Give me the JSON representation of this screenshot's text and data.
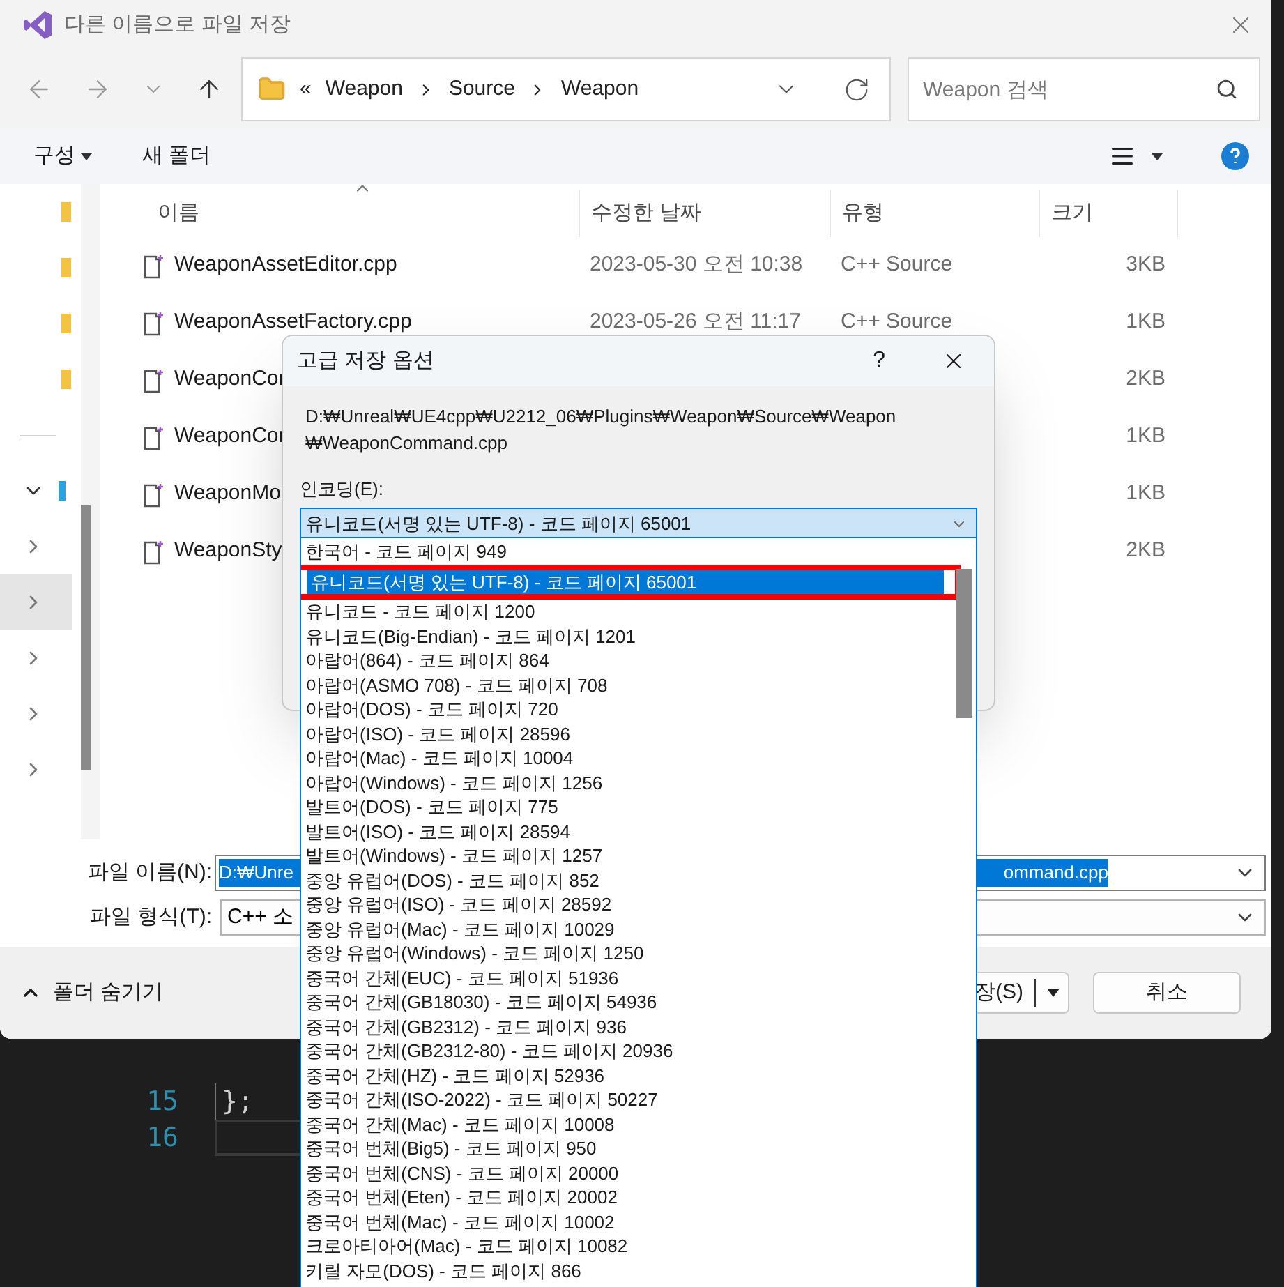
{
  "window": {
    "title": "다른 이름으로 파일 저장"
  },
  "address_bar": {
    "overflow": "«",
    "path": [
      "Weapon",
      "Source",
      "Weapon"
    ]
  },
  "search": {
    "placeholder": "Weapon 검색"
  },
  "toolbar": {
    "organize": "구성",
    "new_folder": "새 폴더"
  },
  "nav_pane": {
    "items": [
      {
        "kind": "folder"
      },
      {
        "kind": "folder"
      },
      {
        "kind": "folder"
      },
      {
        "kind": "folder"
      },
      {
        "kind": "divider"
      },
      {
        "kind": "node",
        "expanded": true,
        "selected": false
      },
      {
        "kind": "node",
        "expanded": false,
        "selected": false
      },
      {
        "kind": "node",
        "expanded": false,
        "selected": true
      },
      {
        "kind": "node",
        "expanded": false,
        "selected": false
      },
      {
        "kind": "node",
        "expanded": false,
        "selected": false
      },
      {
        "kind": "node",
        "expanded": false,
        "selected": false
      }
    ]
  },
  "columns": [
    "이름",
    "수정한 날짜",
    "유형",
    "크기"
  ],
  "files": [
    {
      "name": "WeaponAssetEditor.cpp",
      "modified": "2023-05-30 오전 10:38",
      "type": "C++ Source",
      "size": "3KB"
    },
    {
      "name": "WeaponAssetFactory.cpp",
      "modified": "2023-05-26 오전 11:17",
      "type": "C++ Source",
      "size": "1KB"
    },
    {
      "name": "WeaponCor",
      "size": "2KB"
    },
    {
      "name": "WeaponCor",
      "size": "1KB"
    },
    {
      "name": "WeaponMo",
      "size": "1KB"
    },
    {
      "name": "WeaponSty",
      "size": "2KB"
    }
  ],
  "file_name": {
    "label": "파일 이름(N):",
    "value_start": "D:₩Unre",
    "value_end": "ommand.cpp"
  },
  "file_type": {
    "label": "파일 형식(T):",
    "value": "C++ 소"
  },
  "hide_folders": "폴더 숨기기",
  "save_button": "장(S)",
  "cancel_button": "취소",
  "advanced_dialog": {
    "title": "고급 저장 옵션",
    "help": "?",
    "path_lines": [
      "D:₩Unreal₩UE4cpp₩U2212_06₩Plugins₩Weapon₩Source₩Weapon",
      "₩WeaponCommand.cpp"
    ],
    "encoding_label": "인코딩(E):",
    "encoding_value": "유니코드(서명 있는 UTF-8) - 코드 페이지 65001",
    "options": [
      {
        "label": "한국어 - 코드 페이지 949",
        "selected": false,
        "marked": false
      },
      {
        "label": "유니코드(서명 있는 UTF-8) - 코드 페이지 65001",
        "selected": true,
        "marked": true
      },
      {
        "label": "유니코드 - 코드 페이지 1200",
        "selected": false,
        "marked": false
      },
      {
        "label": "유니코드(Big-Endian) - 코드 페이지 1201",
        "selected": false,
        "marked": false
      },
      {
        "label": "아랍어(864) - 코드 페이지 864",
        "selected": false,
        "marked": false
      },
      {
        "label": "아랍어(ASMO 708) - 코드 페이지 708",
        "selected": false,
        "marked": false
      },
      {
        "label": "아랍어(DOS) - 코드 페이지 720",
        "selected": false,
        "marked": false
      },
      {
        "label": "아랍어(ISO) - 코드 페이지 28596",
        "selected": false,
        "marked": false
      },
      {
        "label": "아랍어(Mac) - 코드 페이지 10004",
        "selected": false,
        "marked": false
      },
      {
        "label": "아랍어(Windows) - 코드 페이지 1256",
        "selected": false,
        "marked": false
      },
      {
        "label": "발트어(DOS) - 코드 페이지 775",
        "selected": false,
        "marked": false
      },
      {
        "label": "발트어(ISO) - 코드 페이지 28594",
        "selected": false,
        "marked": false
      },
      {
        "label": "발트어(Windows) - 코드 페이지 1257",
        "selected": false,
        "marked": false
      },
      {
        "label": "중앙 유럽어(DOS) - 코드 페이지 852",
        "selected": false,
        "marked": false
      },
      {
        "label": "중앙 유럽어(ISO) - 코드 페이지 28592",
        "selected": false,
        "marked": false
      },
      {
        "label": "중앙 유럽어(Mac) - 코드 페이지 10029",
        "selected": false,
        "marked": false
      },
      {
        "label": "중앙 유럽어(Windows) - 코드 페이지 1250",
        "selected": false,
        "marked": false
      },
      {
        "label": "중국어 간체(EUC) - 코드 페이지 51936",
        "selected": false,
        "marked": false
      },
      {
        "label": "중국어 간체(GB18030) - 코드 페이지 54936",
        "selected": false,
        "marked": false
      },
      {
        "label": "중국어 간체(GB2312) - 코드 페이지 936",
        "selected": false,
        "marked": false
      },
      {
        "label": "중국어 간체(GB2312-80) - 코드 페이지 20936",
        "selected": false,
        "marked": false
      },
      {
        "label": "중국어 간체(HZ) - 코드 페이지 52936",
        "selected": false,
        "marked": false
      },
      {
        "label": "중국어 간체(ISO-2022) - 코드 페이지 50227",
        "selected": false,
        "marked": false
      },
      {
        "label": "중국어 간체(Mac) - 코드 페이지 10008",
        "selected": false,
        "marked": false
      },
      {
        "label": "중국어 번체(Big5) - 코드 페이지 950",
        "selected": false,
        "marked": false
      },
      {
        "label": "중국어 번체(CNS) - 코드 페이지 20000",
        "selected": false,
        "marked": false
      },
      {
        "label": "중국어 번체(Eten) - 코드 페이지 20002",
        "selected": false,
        "marked": false
      },
      {
        "label": "중국어 번체(Mac) - 코드 페이지 10002",
        "selected": false,
        "marked": false
      },
      {
        "label": "크로아티아어(Mac) - 코드 페이지 10082",
        "selected": false,
        "marked": false
      },
      {
        "label": "키릴 자모(DOS) - 코드 페이지 866",
        "selected": false,
        "marked": false
      }
    ]
  },
  "editor": {
    "lines": [
      {
        "number": "15",
        "code": "};"
      },
      {
        "number": "16"
      }
    ]
  }
}
